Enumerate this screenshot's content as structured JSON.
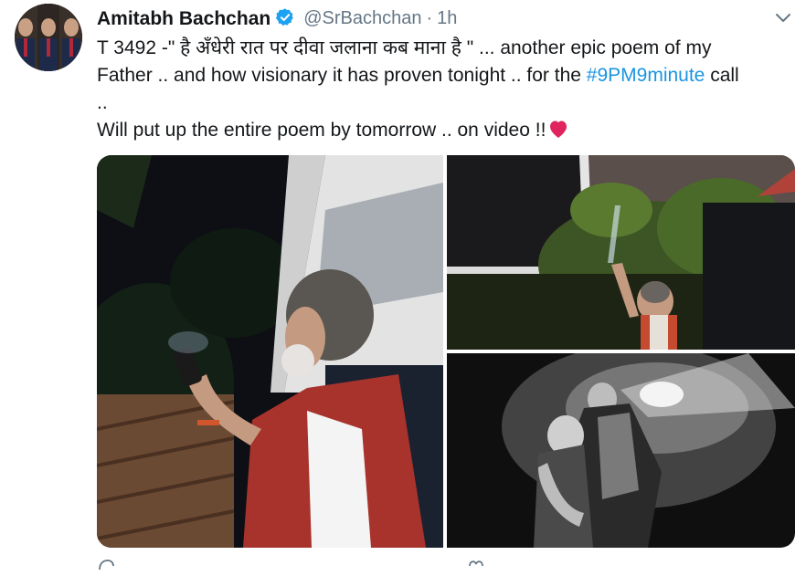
{
  "tweet": {
    "author_name": "Amitabh Bachchan",
    "handle": "@SrBachchan",
    "separator": "·",
    "timestamp": "1h",
    "text_line1": "T 3492 -\" है अँधेरी रात पर दीवा जलाना कब माना है  \" ... another epic poem of my",
    "text_line2_a": "Father .. and how visionary it has proven tonight ..  for the ",
    "hashtag": "#9PM9minute",
    "text_line2_b": "  call",
    "text_line3": "..",
    "text_line4": "Will put up the entire poem by tomorrow .. on video !!",
    "hashtag_color": "#1b95e0",
    "verified_color": "#1da1f2",
    "heart_color": "#e0245e"
  },
  "icons": {
    "verified": "verified-badge-icon",
    "caret": "chevron-down-icon",
    "heart": "red-heart-emoji",
    "reply": "reply-icon",
    "like": "like-icon"
  },
  "media": {
    "photo_count": 3
  }
}
